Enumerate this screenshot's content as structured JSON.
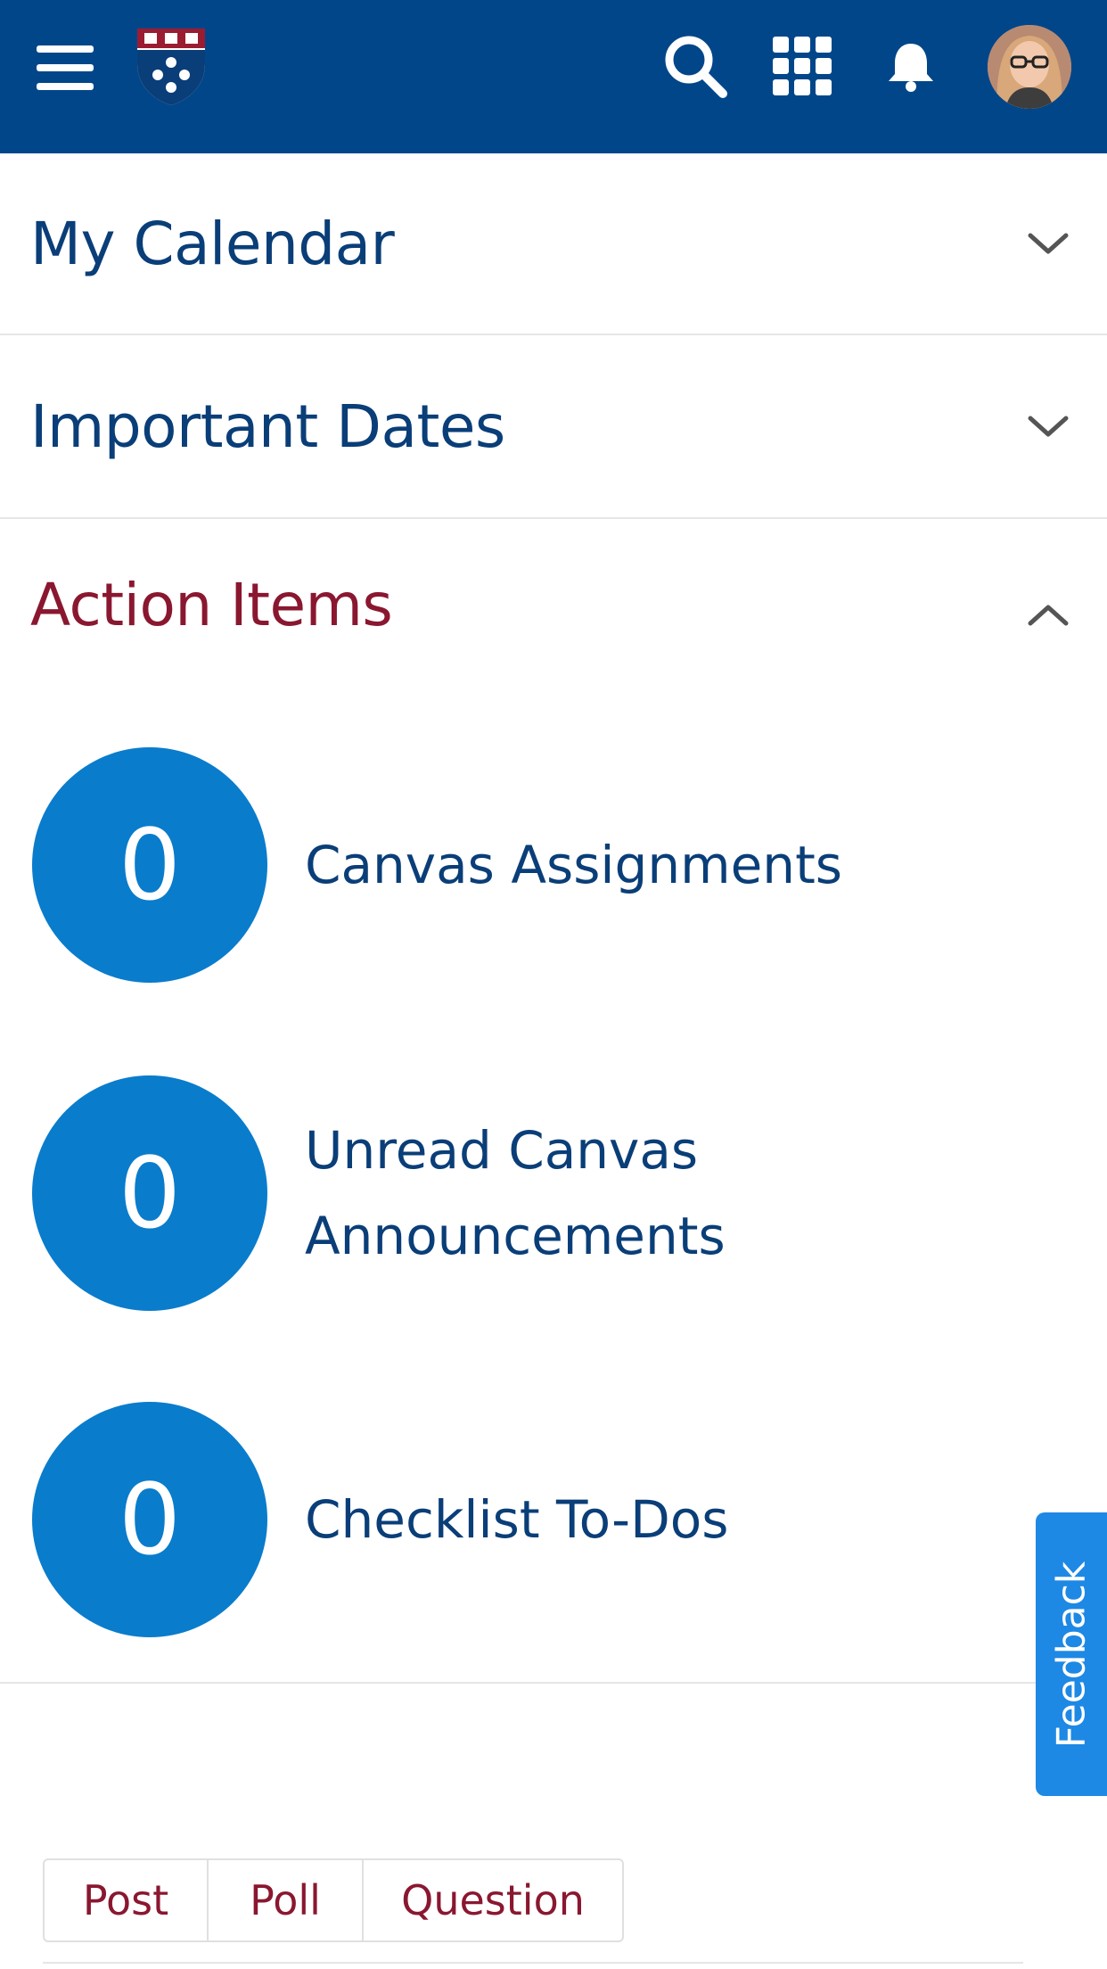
{
  "header": {
    "menu_icon": "hamburger-menu-icon",
    "logo_icon": "penn-shield-logo",
    "search_icon": "search-icon",
    "apps_icon": "apps-grid-icon",
    "bell_icon": "bell-icon",
    "avatar_label": "user avatar",
    "colors": {
      "background": "#02468a",
      "icon": "#ffffff"
    }
  },
  "sections": [
    {
      "title": "My Calendar",
      "expanded": false,
      "chevron": "chevron-down-icon"
    },
    {
      "title": "Important Dates",
      "expanded": false,
      "chevron": "chevron-down-icon"
    },
    {
      "title": "Action Items",
      "expanded": true,
      "chevron": "chevron-up-icon"
    }
  ],
  "action_items": [
    {
      "count": "0",
      "label": "Canvas Assignments"
    },
    {
      "count": "0",
      "label": "Unread Canvas Announcements"
    },
    {
      "count": "0",
      "label": "Checklist To-Dos"
    }
  ],
  "feedback": {
    "label": "Feedback"
  },
  "post_tabs": [
    "Post",
    "Poll",
    "Question"
  ],
  "colors": {
    "title_blue": "#0a3e78",
    "active_title": "#8a1730",
    "count_circle": "#0a7ccc",
    "feedback_tab": "#1e88e5"
  }
}
